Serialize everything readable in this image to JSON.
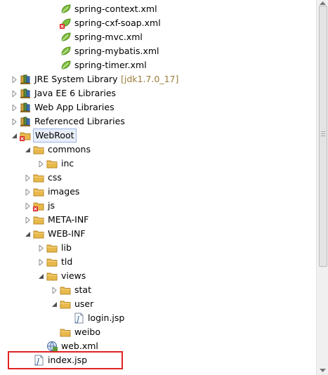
{
  "tree": {
    "items": [
      {
        "label": "spring-context.xml",
        "icon": "xml-file-icon",
        "expander": "none",
        "level": 3
      },
      {
        "label": "spring-cxf-soap.xml",
        "icon": "xml-file-error-icon",
        "expander": "none",
        "level": 3
      },
      {
        "label": "spring-mvc.xml",
        "icon": "xml-file-icon",
        "expander": "none",
        "level": 3
      },
      {
        "label": "spring-mybatis.xml",
        "icon": "xml-file-icon",
        "expander": "none",
        "level": 3
      },
      {
        "label": "spring-timer.xml",
        "icon": "xml-file-icon",
        "expander": "none",
        "level": 3
      },
      {
        "label": "JRE System Library",
        "decoration": "[jdk1.7.0_17]",
        "icon": "library-icon",
        "expander": "collapsed",
        "level": 0
      },
      {
        "label": "Java EE 6 Libraries",
        "icon": "library-icon",
        "expander": "collapsed",
        "level": 0
      },
      {
        "label": "Web App Libraries",
        "icon": "library-icon",
        "expander": "collapsed",
        "level": 0
      },
      {
        "label": "Referenced Libraries",
        "icon": "library-icon",
        "expander": "collapsed",
        "level": 0
      },
      {
        "label": "WebRoot",
        "icon": "webroot-folder-icon",
        "expander": "expanded",
        "level": 0,
        "selected": true
      },
      {
        "label": "commons",
        "icon": "folder-icon",
        "expander": "expanded",
        "level": 1
      },
      {
        "label": "inc",
        "icon": "folder-icon",
        "expander": "collapsed",
        "level": 2
      },
      {
        "label": "css",
        "icon": "folder-icon",
        "expander": "collapsed",
        "level": 1
      },
      {
        "label": "images",
        "icon": "folder-icon",
        "expander": "collapsed",
        "level": 1
      },
      {
        "label": "js",
        "icon": "folder-error-icon",
        "expander": "collapsed",
        "level": 1
      },
      {
        "label": "META-INF",
        "icon": "folder-icon",
        "expander": "collapsed",
        "level": 1
      },
      {
        "label": "WEB-INF",
        "icon": "folder-icon",
        "expander": "expanded",
        "level": 1
      },
      {
        "label": "lib",
        "icon": "folder-icon",
        "expander": "collapsed",
        "level": 2
      },
      {
        "label": "tld",
        "icon": "folder-icon",
        "expander": "collapsed",
        "level": 2
      },
      {
        "label": "views",
        "icon": "folder-icon",
        "expander": "expanded",
        "level": 2
      },
      {
        "label": "stat",
        "icon": "folder-icon",
        "expander": "collapsed",
        "level": 3
      },
      {
        "label": "user",
        "icon": "folder-icon",
        "expander": "expanded",
        "level": 3
      },
      {
        "label": "login.jsp",
        "icon": "jsp-file-icon",
        "expander": "none",
        "level": 4
      },
      {
        "label": "weibo",
        "icon": "folder-icon",
        "expander": "none",
        "level": 3
      },
      {
        "label": "web.xml",
        "icon": "web-xml-icon",
        "expander": "none",
        "level": 2
      },
      {
        "label": "index.jsp",
        "icon": "jsp-file-icon",
        "expander": "none",
        "level": 1,
        "highlighted": true
      }
    ]
  },
  "colors": {
    "highlight_box": "#e02323",
    "selection_bg": "#e8eef8",
    "folder": "#e8b84a",
    "decoration_text": "#9a7d3a"
  }
}
